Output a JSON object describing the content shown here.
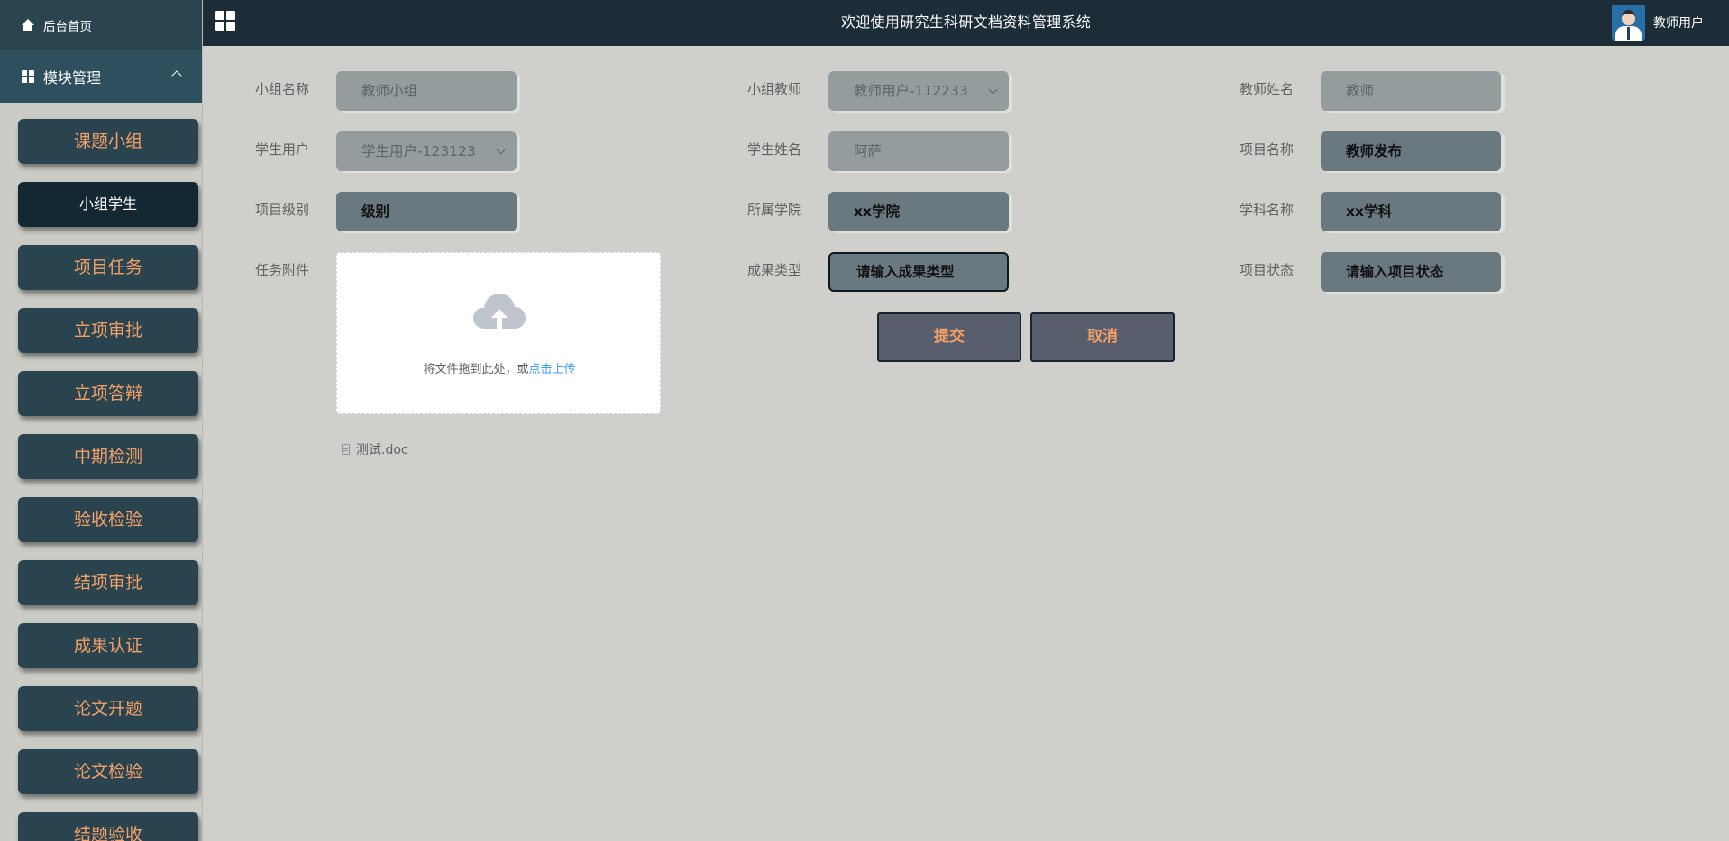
{
  "header": {
    "title": "欢迎使用研究生科研文档资料管理系统",
    "username": "教师用户",
    "menu_toggle_icon": "grid-icon",
    "background": "#1c2d38"
  },
  "sidebar": {
    "home_label": "后台首页",
    "module_label": "模块管理",
    "accent_color": "#f4a068",
    "items": [
      {
        "label": "课题小组",
        "active": false
      },
      {
        "label": "小组学生",
        "active": true
      },
      {
        "label": "项目任务",
        "active": false
      },
      {
        "label": "立项审批",
        "active": false
      },
      {
        "label": "立项答辩",
        "active": false
      },
      {
        "label": "中期检测",
        "active": false
      },
      {
        "label": "验收检验",
        "active": false
      },
      {
        "label": "结项审批",
        "active": false
      },
      {
        "label": "成果认证",
        "active": false
      },
      {
        "label": "论文开题",
        "active": false
      },
      {
        "label": "论文检验",
        "active": false
      },
      {
        "label": "结题验收",
        "active": false
      }
    ]
  },
  "form": {
    "group_name": {
      "label": "小组名称",
      "value": "教师小组",
      "disabled": true
    },
    "group_teacher": {
      "label": "小组教师",
      "value": "教师用户-112233",
      "disabled": true,
      "type": "select"
    },
    "teacher_name": {
      "label": "教师姓名",
      "value": "教师",
      "disabled": true
    },
    "student_user": {
      "label": "学生用户",
      "value": "学生用户-123123",
      "disabled": true,
      "type": "select"
    },
    "student_name": {
      "label": "学生姓名",
      "value": "阿萨",
      "disabled": true
    },
    "project_name": {
      "label": "项目名称",
      "value": "教师发布"
    },
    "project_level": {
      "label": "项目级别",
      "value": "级别"
    },
    "college": {
      "label": "所属学院",
      "value": "xx学院"
    },
    "subject_name": {
      "label": "学科名称",
      "value": "xx学科"
    },
    "attachment": {
      "label": "任务附件",
      "drop_text": "将文件拖到此处，或",
      "click_text": "点击上传",
      "files": [
        "测试.doc"
      ]
    },
    "result_type": {
      "label": "成果类型",
      "placeholder": "请输入成果类型"
    },
    "project_status": {
      "label": "项目状态",
      "placeholder": "请输入项目状态"
    },
    "submit_label": "提交",
    "cancel_label": "取消"
  }
}
